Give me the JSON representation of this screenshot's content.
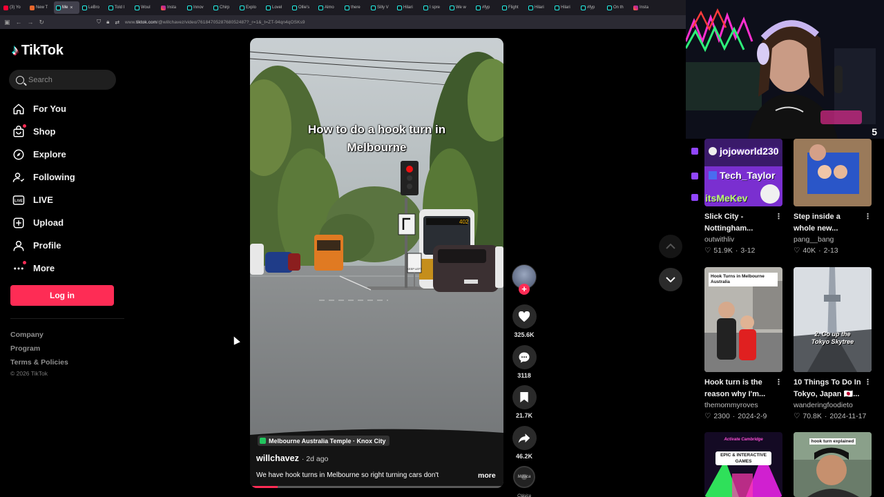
{
  "tabs": [
    {
      "label": "(3) Yo",
      "icon": "yt"
    },
    {
      "label": "New T",
      "icon": "orange"
    },
    {
      "label": "Me",
      "icon": "tt",
      "active": true,
      "close": "×"
    },
    {
      "label": "LeBro",
      "icon": "tt"
    },
    {
      "label": "Told I",
      "icon": "tt"
    },
    {
      "label": "Woul",
      "icon": "tt"
    },
    {
      "label": "Insta",
      "icon": "ig"
    },
    {
      "label": "Innov",
      "icon": "tt"
    },
    {
      "label": "Chirp",
      "icon": "tt"
    },
    {
      "label": "Explo",
      "icon": "tt"
    },
    {
      "label": "Lovel",
      "icon": "tt"
    },
    {
      "label": "Ollie's",
      "icon": "tt"
    },
    {
      "label": "Almo",
      "icon": "tt"
    },
    {
      "label": "there",
      "icon": "tt"
    },
    {
      "label": "Silly V",
      "icon": "tt"
    },
    {
      "label": "Hilari",
      "icon": "tt"
    },
    {
      "label": "I spre",
      "icon": "tt"
    },
    {
      "label": "We w",
      "icon": "tt"
    },
    {
      "label": "#fyp",
      "icon": "tt"
    },
    {
      "label": "Flight",
      "icon": "tt"
    },
    {
      "label": "Hilari",
      "icon": "tt"
    },
    {
      "label": "Hilari",
      "icon": "tt"
    },
    {
      "label": "#fyp",
      "icon": "tt"
    },
    {
      "label": "On th",
      "icon": "tt"
    },
    {
      "label": "Insta",
      "icon": "ig"
    }
  ],
  "url": {
    "prefix": "www.",
    "host": "tiktok.com",
    "path": "/@willchavez/video/7618470528768052487?_r=1&_t=ZT-94qn4qOSKs9"
  },
  "brand": {
    "name": "TikTok"
  },
  "search": {
    "placeholder": "Search"
  },
  "nav": [
    {
      "label": "For You",
      "icon": "home-icon"
    },
    {
      "label": "Shop",
      "icon": "shop-icon",
      "dot": true
    },
    {
      "label": "Explore",
      "icon": "compass-icon"
    },
    {
      "label": "Following",
      "icon": "following-icon"
    },
    {
      "label": "LIVE",
      "icon": "live-icon"
    },
    {
      "label": "Upload",
      "icon": "upload-icon"
    },
    {
      "label": "Profile",
      "icon": "profile-icon"
    },
    {
      "label": "More",
      "icon": "more-icon",
      "dot": true
    }
  ],
  "login_label": "Log in",
  "footer": {
    "links": [
      "Company",
      "Program",
      "Terms & Policies"
    ],
    "copyright": "© 2026 TikTok"
  },
  "video": {
    "overlay_text": "How to do a hook turn in Melbourne",
    "location": "Melbourne Australia Temple · Knox City",
    "author": "willchavez",
    "age": "· 2d ago",
    "description": "We have hook turns in Melbourne so right turning cars don't",
    "more": "more",
    "progress": 0.11,
    "bus_number": "402",
    "sign_text": "KEEP LEFT"
  },
  "actions": {
    "likes": "325.6K",
    "comments": "3118",
    "saves": "21.7K",
    "shares": "46.2K",
    "music_label": "Música Clásica"
  },
  "webcam": {
    "overlay_digit": "5"
  },
  "chat_overlay": [
    "jojoworld230",
    "Tech_Taylor",
    "itsMeKev"
  ],
  "recommended": [
    {
      "title": "Slick City - Nottingham...",
      "author": "outwithliv",
      "likes": "51.9K",
      "date": "3-12"
    },
    {
      "title": "Step inside a whole new...",
      "author": "pang__bang",
      "likes": "40K",
      "date": "2-13"
    },
    {
      "title": "Hook turn is the reason why I'm...",
      "author": "themommyroves",
      "likes": "2300",
      "date": "2024-2-9",
      "thumb_text": "Hook Turns in Melbourne Australia"
    },
    {
      "title": "10 Things To Do In Tokyo, Japan 🇯🇵...",
      "author": "wanderingfoodieto",
      "likes": "70.8K",
      "date": "2024-11-17",
      "thumb_text": "2. Go up the Tokyo Skytree"
    },
    {
      "title": "",
      "thumb_text": "EPIC & INTERACTIVE GAMES",
      "thumb_caption": "Activate Cambridge"
    },
    {
      "title": "",
      "thumb_text": "hook turn explained"
    }
  ],
  "colors": {
    "accent": "#fe2c55",
    "twitch": "#9146ff"
  }
}
